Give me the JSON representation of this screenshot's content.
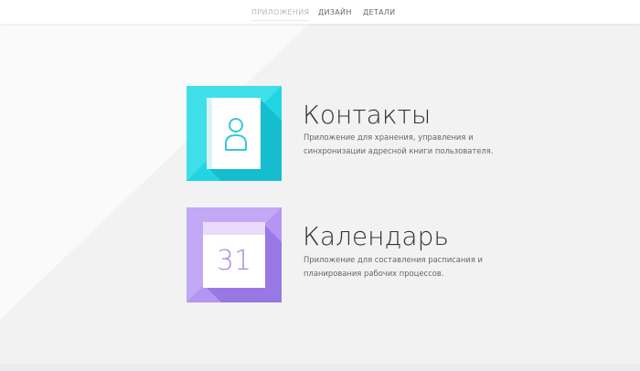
{
  "nav": {
    "items": [
      {
        "label": "ПРИЛОЖЕНИЯ",
        "active": true
      },
      {
        "label": "ДИЗАЙН",
        "active": false
      },
      {
        "label": "ДЕТАЛИ",
        "active": false
      }
    ]
  },
  "apps": [
    {
      "title": "Контакты",
      "description": "Приложение для хранения, управления и синхронизации адресной книги пользователя.",
      "icon": "contacts-icon",
      "color": "#1fd1e0"
    },
    {
      "title": "Календарь",
      "description": "Приложение для составления расписания и планирования рабочих процессов.",
      "icon": "calendar-icon",
      "icon_number": "31",
      "color": "#ae8df0"
    }
  ],
  "colors": {
    "background": "#f3f3f3",
    "background_light": "#fafafa",
    "contacts_accent": "#1fd1e0",
    "calendar_accent": "#ae8df0"
  }
}
